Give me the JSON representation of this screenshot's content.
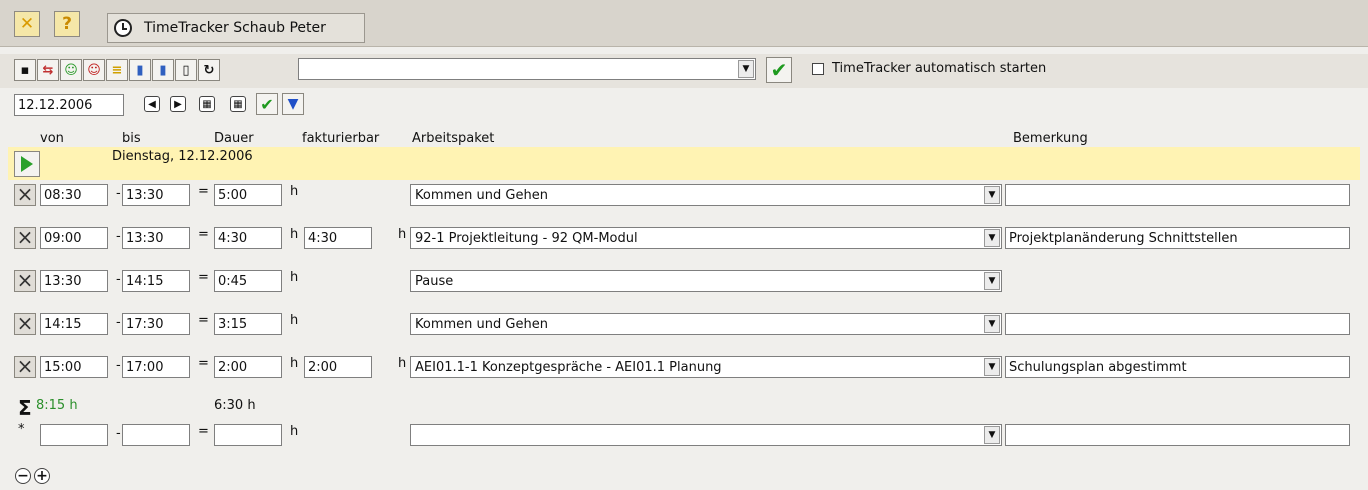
{
  "app": {
    "title": "TimeTracker Schaub Peter"
  },
  "toolbar": {
    "autostart_label": "TimeTracker automatisch starten",
    "project_combo_value": ""
  },
  "date": {
    "value": "12.12.2006",
    "day_label": "Dienstag, 12.12.2006"
  },
  "columns": {
    "von": "von",
    "bis": "bis",
    "dauer": "Dauer",
    "fakturierbar": "fakturierbar",
    "arbeitspaket": "Arbeitspaket",
    "bemerkung": "Bemerkung"
  },
  "entries": [
    {
      "von": "08:30",
      "bis": "13:30",
      "dauer": "5:00",
      "fakturierbar": "",
      "arbeitspaket": "Kommen und Gehen",
      "bemerkung": ""
    },
    {
      "von": "09:00",
      "bis": "13:30",
      "dauer": "4:30",
      "fakturierbar": "4:30",
      "arbeitspaket": "92-1 Projektleitung - 92 QM-Modul",
      "bemerkung": "Projektplanänderung Schnittstellen"
    },
    {
      "von": "13:30",
      "bis": "14:15",
      "dauer": "0:45",
      "fakturierbar": "",
      "arbeitspaket": "Pause",
      "bemerkung": ""
    },
    {
      "von": "14:15",
      "bis": "17:30",
      "dauer": "3:15",
      "fakturierbar": "",
      "arbeitspaket": "Kommen und Gehen",
      "bemerkung": ""
    },
    {
      "von": "15:00",
      "bis": "17:00",
      "dauer": "2:00",
      "fakturierbar": "2:00",
      "arbeitspaket": "AEI01.1-1 Konzeptgespräche - AEI01.1 Planung",
      "bemerkung": "Schulungsplan abgestimmt"
    }
  ],
  "totals": {
    "total": "8:15 h",
    "billable": "6:30 h"
  },
  "symbols": {
    "unit": "h",
    "dash": "-",
    "equals": "=",
    "new_marker": "*"
  },
  "colors": {
    "band": "#fff3b3",
    "accent_green": "#2b8f2b"
  }
}
